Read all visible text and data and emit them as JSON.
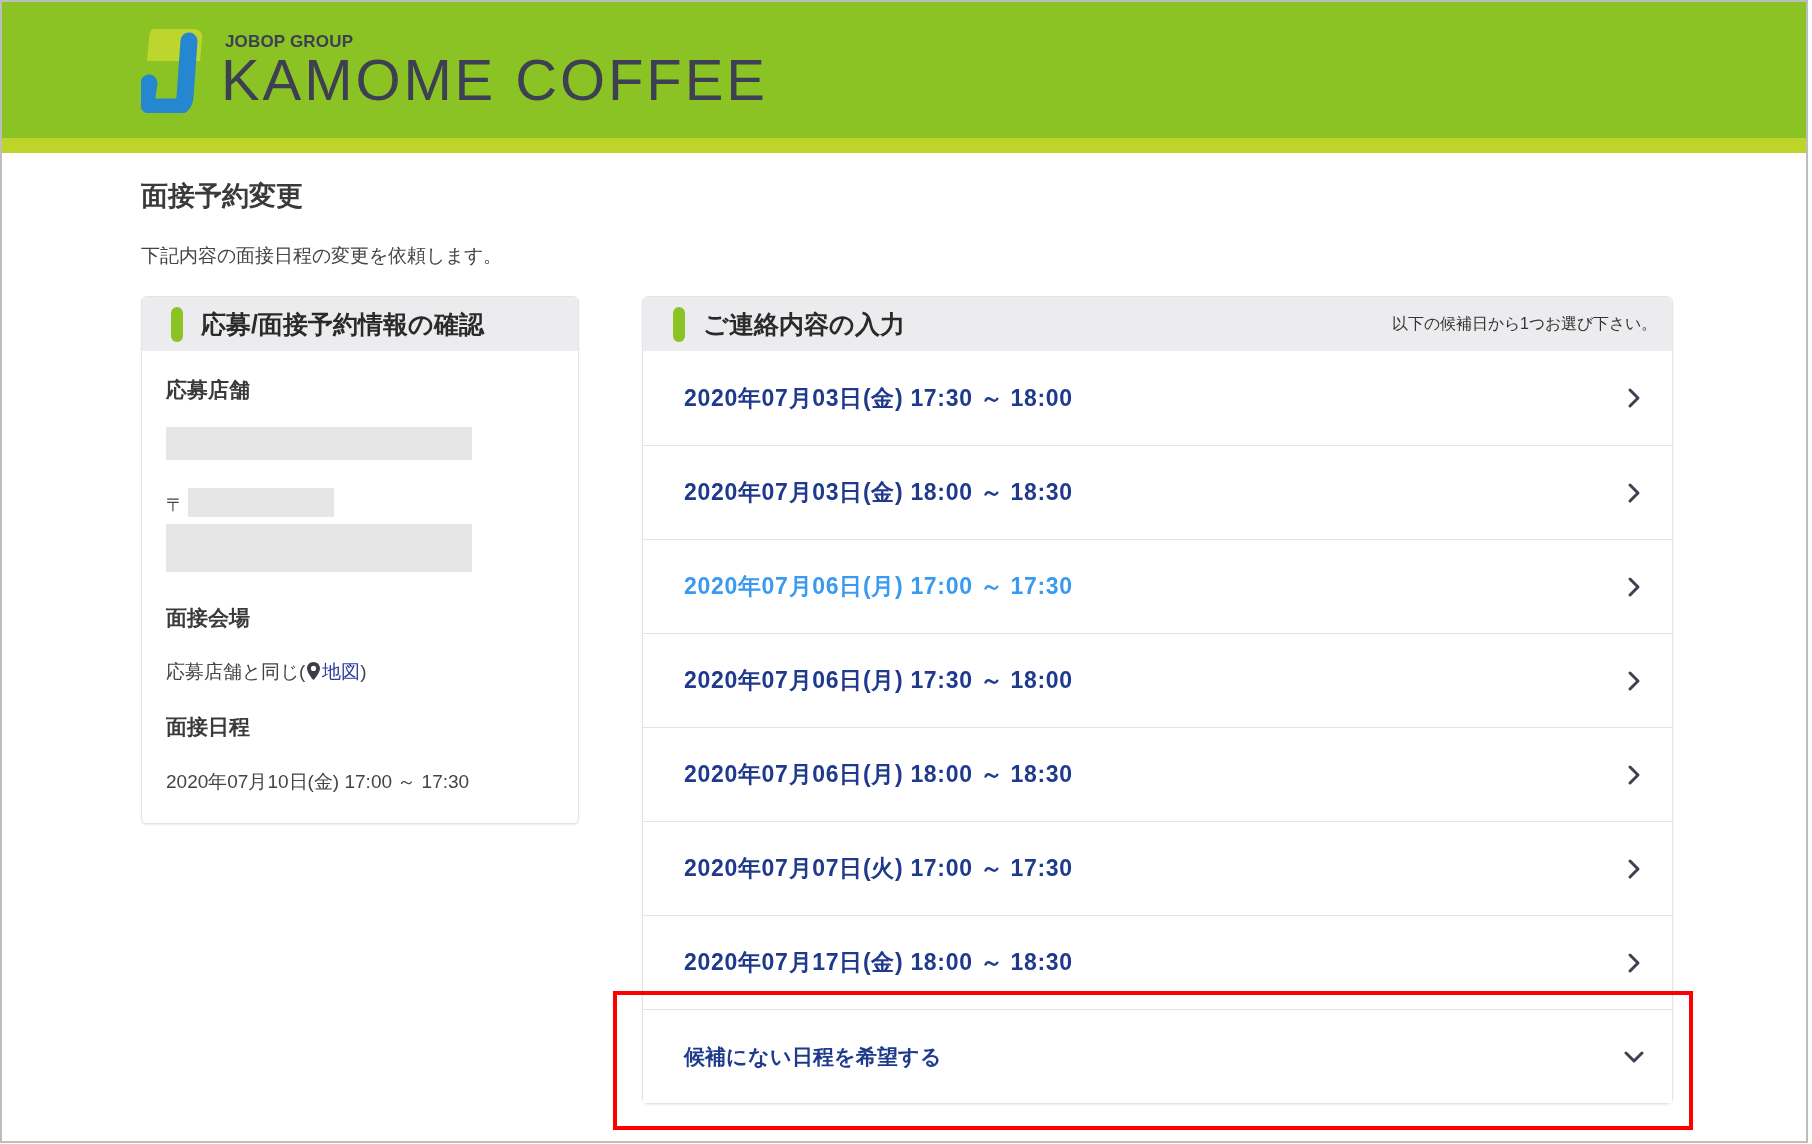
{
  "header": {
    "logo_group": "JOBOP GROUP",
    "logo_name": "KAMOME COFFEE"
  },
  "page_title": "面接予約変更",
  "intro": "下記内容の面接日程の変更を依頼します。",
  "confirmation_panel": {
    "title": "応募/面接予約情報の確認",
    "sections": [
      {
        "kind": "redacted_address",
        "label": "応募店舗",
        "postal_mark": "〒"
      },
      {
        "kind": "venue",
        "label": "面接会場",
        "text": "応募店舗と同じ(",
        "link": "地図",
        "suffix": ")"
      },
      {
        "kind": "text",
        "label": "面接日程",
        "text": "2020年07月10日(金) 17:00 ～ 17:30"
      }
    ]
  },
  "contact_panel": {
    "title": "ご連絡内容の入力",
    "note": "以下の候補日から1つお選び下さい。",
    "options": [
      {
        "kind": "slot",
        "label": "2020年07月03日(金) 17:30 ～ 18:00",
        "selected": false
      },
      {
        "kind": "slot",
        "label": "2020年07月03日(金) 18:00 ～ 18:30",
        "selected": false
      },
      {
        "kind": "slot",
        "label": "2020年07月06日(月) 17:00 ～ 17:30",
        "selected": true
      },
      {
        "kind": "slot",
        "label": "2020年07月06日(月) 17:30 ～ 18:00",
        "selected": false
      },
      {
        "kind": "slot",
        "label": "2020年07月06日(月) 18:00 ～ 18:30",
        "selected": false
      },
      {
        "kind": "slot",
        "label": "2020年07月07日(火) 17:00 ～ 17:30",
        "selected": false
      },
      {
        "kind": "slot",
        "label": "2020年07月17日(金) 18:00 ～ 18:30",
        "selected": false
      },
      {
        "kind": "other",
        "label": "候補にない日程を希望する",
        "expanded": false,
        "callout": true
      }
    ]
  }
}
